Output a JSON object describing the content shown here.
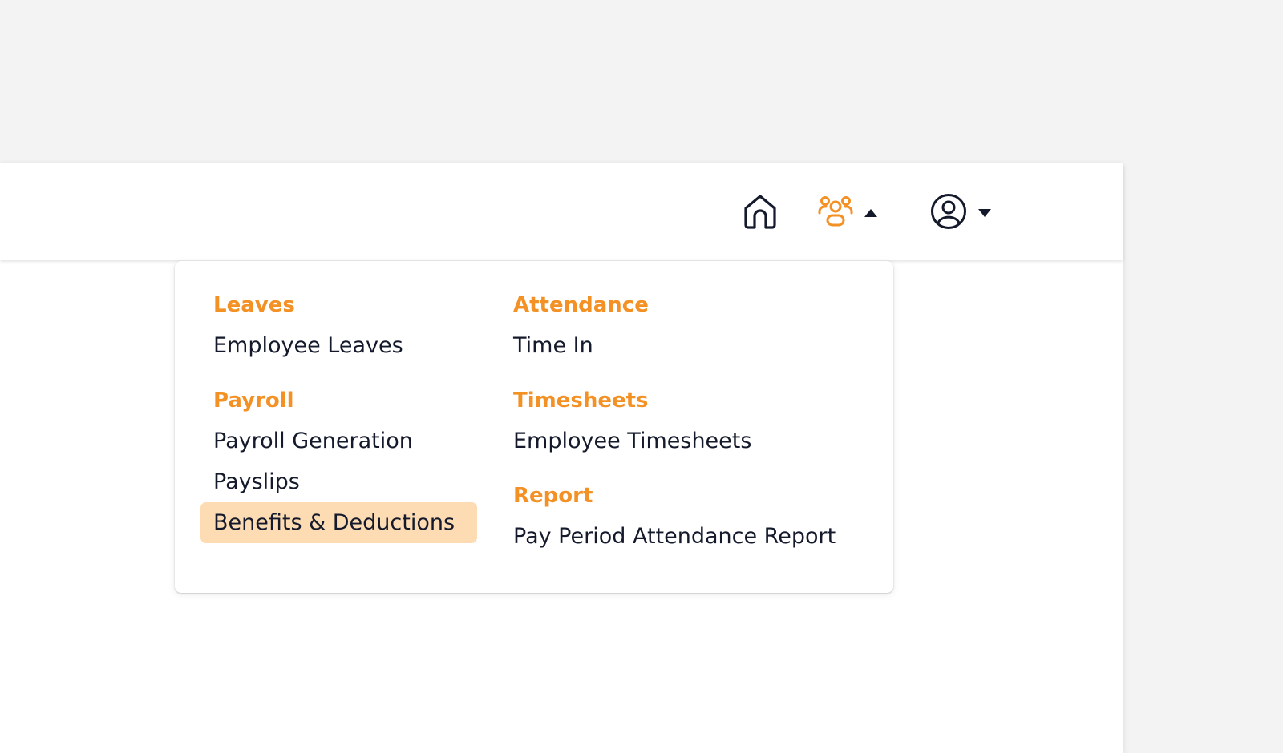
{
  "colors": {
    "accent": "#f39125",
    "highlight": "#fddcb4",
    "text": "#141a2b",
    "background": "#f3f3f3",
    "panel": "#ffffff"
  },
  "nav": {
    "items": [
      {
        "icon": "home-icon"
      },
      {
        "icon": "team-icon",
        "caret": "caret-up-icon",
        "active": true
      },
      {
        "icon": "user-circle-icon",
        "caret": "caret-down-icon"
      }
    ]
  },
  "menu": {
    "leaves": {
      "title": "Leaves",
      "items": [
        "Employee Leaves"
      ]
    },
    "payroll": {
      "title": "Payroll",
      "items": [
        "Payroll Generation",
        "Payslips",
        "Benefits & Deductions"
      ],
      "selected": "Benefits & Deductions"
    },
    "attendance": {
      "title": "Attendance",
      "items": [
        "Time In"
      ]
    },
    "timesheets": {
      "title": "Timesheets",
      "items": [
        "Employee Timesheets"
      ]
    },
    "report": {
      "title": "Report",
      "items": [
        "Pay Period Attendance Report"
      ]
    }
  }
}
